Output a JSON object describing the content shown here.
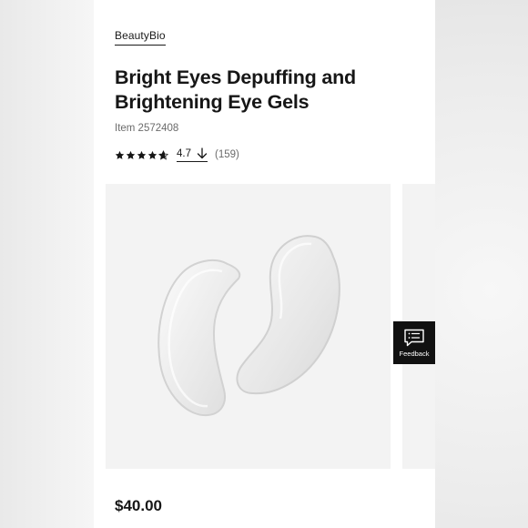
{
  "product": {
    "brand": "BeautyBio",
    "title": "Bright Eyes Depuffing and Brightening Eye Gels",
    "item_number": "Item 2572408",
    "rating": {
      "value": "4.7",
      "stars_out_of_5": 4.7,
      "review_count": "(159)",
      "star_icon": "star-icon",
      "sort_icon": "arrow-down-icon"
    },
    "price": "$40.00"
  },
  "gallery": {
    "main_image_alt": "eye-gel-patches-image",
    "background_color": "#f3f3f3"
  },
  "feedback_tab": {
    "label": "Feedback",
    "icon": "chat-list-icon"
  },
  "colors": {
    "text": "#161616",
    "muted": "#6b6b6b",
    "feedback_bg": "#111111"
  }
}
